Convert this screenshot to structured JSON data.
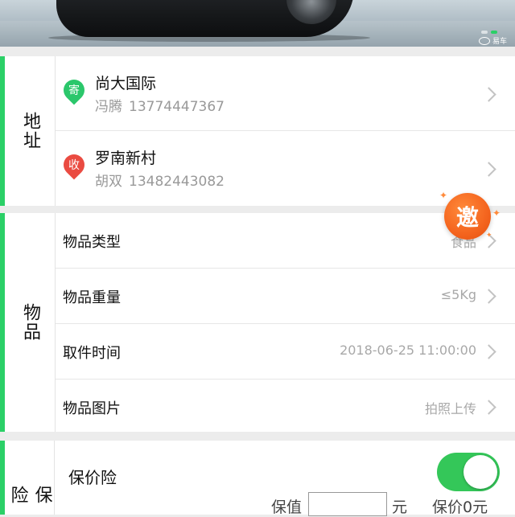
{
  "banner": {
    "brand_logo_text": "易车",
    "carousel_active_index": 1,
    "carousel_count": 2
  },
  "address_section": {
    "label": "地址",
    "sender": {
      "icon_char": "寄",
      "place": "尚大国际",
      "contact_name": "冯腾",
      "phone": "13774447367"
    },
    "receiver": {
      "icon_char": "收",
      "place": "罗南新村",
      "contact_name": "胡双",
      "phone": "13482443082"
    }
  },
  "item_section": {
    "label": "物品",
    "rows": [
      {
        "label": "物品类型",
        "value": "食品"
      },
      {
        "label": "物品重量",
        "value": "≤5Kg"
      },
      {
        "label": "取件时间",
        "value": "2018-06-25 11:00:00"
      },
      {
        "label": "物品图片",
        "value": "拍照上传"
      }
    ]
  },
  "insurance_section": {
    "label": "保险",
    "title": "保价险",
    "toggle_on": true,
    "declared_value_label": "保值",
    "declared_value": "",
    "currency_unit": "元",
    "premium_text": "保价0元"
  },
  "invite_badge": {
    "char": "邀"
  },
  "colors": {
    "accent": "#2bd067",
    "sender_pin": "#2bc76b",
    "receiver_pin": "#ea4b41",
    "invite_badge": "#f4641e",
    "toggle_on": "#34c759"
  }
}
